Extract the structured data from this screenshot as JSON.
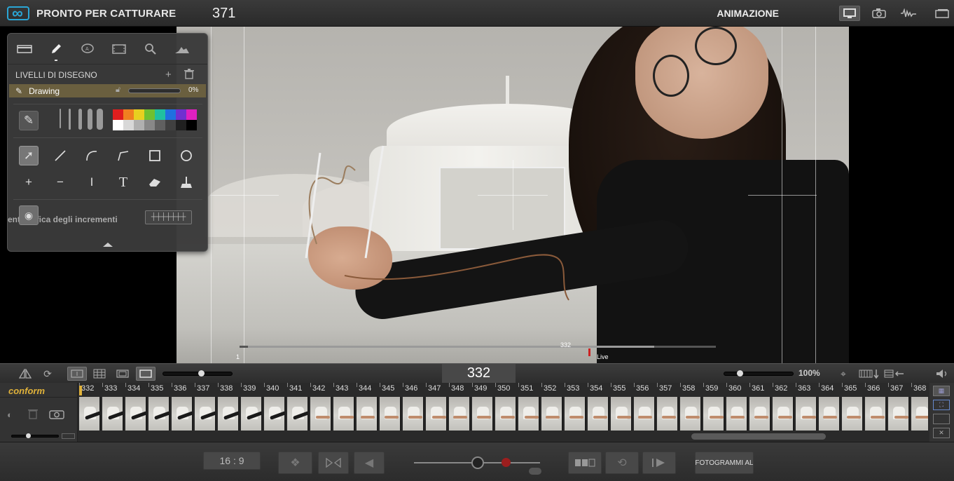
{
  "header": {
    "status": "PRONTO PER CATTURARE",
    "frame_count": "371",
    "mode": "ANIMAZIONE",
    "icons": [
      "logo-icon",
      "display-icon",
      "camera-icon",
      "audio-icon",
      "windows-icon"
    ]
  },
  "viewer": {
    "scrub_start": "1",
    "scrub_marker": "332",
    "live_label": "Live"
  },
  "drawing_panel": {
    "tabs": [
      "frame-tab",
      "pencil-tab",
      "speech-tab",
      "film-tab",
      "zoom-tab",
      "histogram-tab"
    ],
    "layers_title": "LIVELLI DI DISEGNO",
    "layer_name": "Drawing",
    "layer_opacity": "0%",
    "tools": [
      "select",
      "line",
      "curve",
      "polyline",
      "rectangle",
      "ellipse",
      "plus",
      "minus",
      "cursor",
      "text",
      "eraser",
      "brush-fill"
    ],
    "onion_label": "entrodifica degli incrementi",
    "palette": [
      "#e01e1e",
      "#f08020",
      "#e8d020",
      "#70c030",
      "#20c0a0",
      "#2070e0",
      "#7030d0",
      "#e020c0",
      "#ffffff",
      "#d8d8d8",
      "#b0b0b0",
      "#888888",
      "#606060",
      "#404040",
      "#202020",
      "#000000"
    ]
  },
  "timeline": {
    "current_frame": "332",
    "zoom": "100%",
    "conform_label": "conform",
    "frame_numbers": [
      "332",
      "333",
      "334",
      "335",
      "336",
      "337",
      "338",
      "339",
      "340",
      "341",
      "342",
      "343",
      "344",
      "345",
      "346",
      "347",
      "348",
      "349",
      "350",
      "351",
      "352",
      "353",
      "354",
      "355",
      "356",
      "357",
      "358",
      "359",
      "360",
      "361",
      "362",
      "363",
      "364",
      "365",
      "366",
      "367",
      "368"
    ]
  },
  "bottom": {
    "aspect_ratio": "16 : 9",
    "fotogrammi_label": "FOTOGRAMMI AL"
  }
}
